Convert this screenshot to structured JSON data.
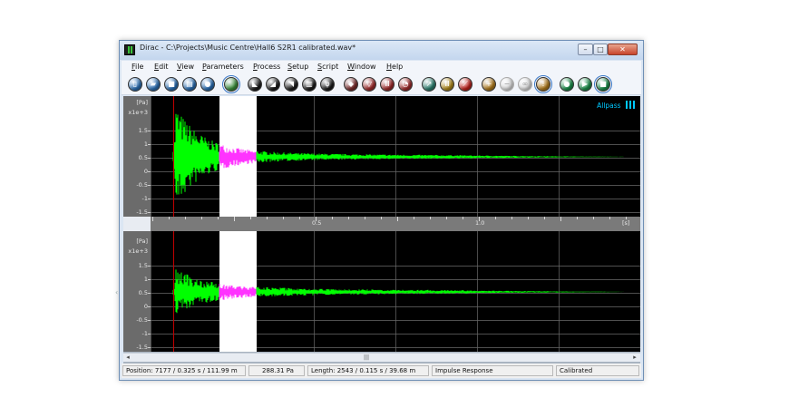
{
  "window": {
    "title": "Dirac - C:\\Projects\\Music Centre\\Hall6 S2R1 calibrated.wav*",
    "min": "–",
    "max": "□",
    "close": "✕"
  },
  "menu": [
    {
      "label": "File",
      "u": "F"
    },
    {
      "label": "Edit",
      "u": "E"
    },
    {
      "label": "View",
      "u": "V"
    },
    {
      "label": "Parameters",
      "u": "P"
    },
    {
      "label": "Process",
      "u": "P"
    },
    {
      "label": "Setup",
      "u": "S"
    },
    {
      "label": "Script",
      "u": "S"
    },
    {
      "label": "Window",
      "u": "W"
    },
    {
      "label": "Help",
      "u": "H"
    }
  ],
  "toolbar": [
    {
      "name": "new-file-icon",
      "color": "#2a6fb5",
      "glyph": "▯"
    },
    {
      "name": "open-file-icon",
      "color": "#2a6fb5",
      "glyph": "▰"
    },
    {
      "name": "save-icon",
      "color": "#2a6fb5",
      "glyph": "■"
    },
    {
      "name": "print-icon",
      "color": "#2a6fb5",
      "glyph": "▤"
    },
    {
      "name": "record-icon",
      "color": "#2a6fb5",
      "glyph": "●"
    },
    {
      "name": "impulse-response-icon",
      "color": "#3a8f3a",
      "glyph": "",
      "selected": true
    },
    {
      "name": "energy-time-icon",
      "color": "#1a1a1a",
      "glyph": "◣"
    },
    {
      "name": "decay-icon",
      "color": "#1a1a1a",
      "glyph": "◢"
    },
    {
      "name": "schroeder-icon",
      "color": "#1a1a1a",
      "glyph": "◥"
    },
    {
      "name": "spectrum-icon",
      "color": "#1a1a1a",
      "glyph": "▥"
    },
    {
      "name": "phase-icon",
      "color": "#1a1a1a",
      "glyph": "φ"
    },
    {
      "name": "waterfall-icon",
      "color": "#7a2a2a",
      "glyph": "◆"
    },
    {
      "name": "filter-icon",
      "color": "#a02a2a",
      "glyph": "▽"
    },
    {
      "name": "bank-icon",
      "color": "#a02a2a",
      "glyph": "Ⅲ"
    },
    {
      "name": "meter-icon",
      "color": "#a02a2a",
      "glyph": "◔"
    },
    {
      "name": "tools-icon",
      "color": "#2a7f6f",
      "glyph": "↗"
    },
    {
      "name": "columns-icon",
      "color": "#b08a1a",
      "glyph": "Ⅲ"
    },
    {
      "name": "marker-icon",
      "color": "#c0201a",
      "glyph": "⟋"
    },
    {
      "name": "add-marker-icon",
      "color": "#b07a1a",
      "glyph": "+"
    },
    {
      "name": "remove-marker-icon",
      "color": "#dcdcdc",
      "glyph": "−"
    },
    {
      "name": "link-icon",
      "color": "#dcdcdc",
      "glyph": "∞"
    },
    {
      "name": "info-icon",
      "color": "#b07a1a",
      "glyph": "!",
      "selected": true
    },
    {
      "name": "rec-icon",
      "color": "#1a8f4a",
      "glyph": "●"
    },
    {
      "name": "play-icon",
      "color": "#1a8f4a",
      "glyph": "▶"
    },
    {
      "name": "stop-icon",
      "color": "#1a8f4a",
      "glyph": "■",
      "selected": true
    }
  ],
  "plot_top": {
    "unit": "[Pa]",
    "scale": "x1e+3",
    "yticks": [
      "1.5",
      "1",
      "0.5",
      "0",
      "-0.5",
      "-1",
      "-1.5"
    ],
    "badge": "Allpass",
    "badge_color": "#00c8ff"
  },
  "plot_bottom": {
    "unit": "[Pa]",
    "scale": "x1e+3",
    "yticks": [
      "1.5",
      "1",
      "0.5",
      "0",
      "-0.5",
      "-1",
      "-1.5"
    ]
  },
  "time_axis": {
    "ticks": [
      "0.5",
      "1.0"
    ],
    "unit": "[s]"
  },
  "scrollbar": {
    "left": "◂",
    "right": "▸",
    "thumb": "|||"
  },
  "status": {
    "position": "Position: 7177 / 0.325 s / 111.99 m",
    "value": "288.31 Pa",
    "length": "Length: 2543 / 0.115 s / 39.68 m",
    "mode": "Impulse Response",
    "calibration": "Calibrated"
  },
  "colors": {
    "signal": "#00ff00",
    "selected": "#ff33ff",
    "marker": "#c00000",
    "grid": "#6a6a6a"
  }
}
